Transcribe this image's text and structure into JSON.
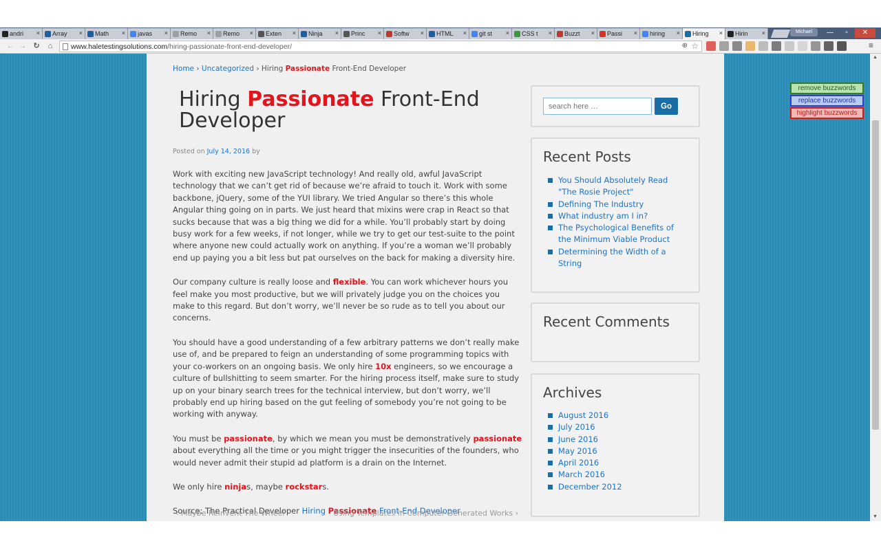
{
  "browser": {
    "tabs": [
      {
        "title": "andri",
        "icon": "github-icon",
        "color": "#222222",
        "active": false
      },
      {
        "title": "Array",
        "icon": "mdn-icon",
        "color": "#1c5fa8",
        "active": false
      },
      {
        "title": "Math",
        "icon": "mdn-icon",
        "color": "#1c5fa8",
        "active": false
      },
      {
        "title": "javas",
        "icon": "google-icon",
        "color": "#4285f4",
        "active": false
      },
      {
        "title": "Remo",
        "icon": "page-icon",
        "color": "#9aa0a6",
        "active": false
      },
      {
        "title": "Remo",
        "icon": "page-icon",
        "color": "#9aa0a6",
        "active": false
      },
      {
        "title": "Exten",
        "icon": "puzzle-icon",
        "color": "#555555",
        "active": false
      },
      {
        "title": "Ninja",
        "icon": "info-icon",
        "color": "#1c5fa8",
        "active": false
      },
      {
        "title": "Princ",
        "icon": "wikipedia-icon",
        "color": "#555555",
        "active": false
      },
      {
        "title": "Softw",
        "icon": "flower-icon",
        "color": "#c0392b",
        "active": false
      },
      {
        "title": "HTML",
        "icon": "mdn-icon",
        "color": "#1c5fa8",
        "active": false
      },
      {
        "title": "git st",
        "icon": "google-icon",
        "color": "#4285f4",
        "active": false
      },
      {
        "title": "CSS t",
        "icon": "css-icon",
        "color": "#3a9a3a",
        "active": false
      },
      {
        "title": "Buzzt",
        "icon": "buzzword-icon",
        "color": "#c0392b",
        "active": false
      },
      {
        "title": "Passi",
        "icon": "gmail-icon",
        "color": "#d93025",
        "active": false
      },
      {
        "title": "hiring",
        "icon": "google-icon",
        "color": "#4285f4",
        "active": false
      },
      {
        "title": "Hiring",
        "icon": "shield-icon",
        "color": "#1a6ea5",
        "active": true
      },
      {
        "title": "Hirin",
        "icon": "dev-icon",
        "color": "#222222",
        "active": false
      }
    ],
    "profile": "Michael",
    "url": {
      "host": "www.haletestingsolutions.com",
      "path": "/hiring-passionate-front-end-developer/"
    },
    "extension_colors": [
      "#d93025",
      "#888888",
      "#666666",
      "#e8a33d",
      "#aaaaaa",
      "#555555",
      "#bbbbbb",
      "#cccccc",
      "#777777",
      "#333333",
      "#222222"
    ]
  },
  "buzz_panel": {
    "remove": "remove buzzwords",
    "replace": "replace buzzwords",
    "highlight": "highlight buzzwords"
  },
  "breadcrumb": {
    "home": "Home",
    "separator": "›",
    "category": "Uncategorized",
    "current_pre": "Hiring ",
    "current_bw": "Passionate",
    "current_post": " Front-End Developer"
  },
  "post": {
    "title_pre": "Hiring ",
    "title_bw": "Passionate",
    "title_post": " Front-End Developer",
    "meta_posted": "Posted on ",
    "meta_date": "July 14, 2016",
    "meta_by": " by",
    "p1": "Work with exciting new JavaScript technology! And really old, awful JavaScript technology that we can’t get rid of because we’re afraid to touch it. Work with some backbone, jQuery, some of the YUI library. We tried Angular so there’s this whole Angular thing going on in parts. We just heard that mixins were crap in React so that sucks because that was a big thing we did for a while. You’ll probably start by doing busy work for a few weeks, if not longer, while we try to get our test-suite to the point where anyone new could actually work on anything. If you’re a woman we’ll probably end up paying you a bit less but pat ourselves on the back for making a diversity hire.",
    "p2_a": "Our company culture is really loose and ",
    "p2_bw": "flexible",
    "p2_b": ". You can work whichever hours you feel make you most productive, but we will privately judge you on the choices you make to this regard. But don’t worry, we’ll never be so rude as to tell you about our concerns.",
    "p3_a": "You should have a good understanding of a few arbitrary patterns we don’t really make use of, and be prepared to feign an understanding of some programming topics with your co-workers on an ongoing basis. We only hire ",
    "p3_bw": "10x",
    "p3_b": " engineers, so we encourage a culture of bullshitting to seem smarter. For the hiring process itself, make sure to study up on your binary search trees for the technical interview, but don’t worry, we’ll probably end up hiring based on the gut feeling of somebody you’re not going to be working with anyway.",
    "p4_a": "You must be ",
    "p4_bw1": "passionate",
    "p4_b": ", by which we mean you must be demonstratively ",
    "p4_bw2": "passionate",
    "p4_c": " about everything all the time or you might trigger the insecurities of the founders, who would never admit their stupid ad platform is a drain on the Internet.",
    "p5_a": "We only hire ",
    "p5_bw1": "ninja",
    "p5_b": "s, maybe ",
    "p5_bw2": "rockstar",
    "p5_c": "s.",
    "source_label": "Source: The Practical Developer ",
    "source_pre": "Hiring ",
    "source_bw": "Passionate",
    "source_post": " Front-End Developer"
  },
  "post_nav": {
    "prev": "‹   Maybe Reinvent The Wheel",
    "next": "Using Templates in Computer-Generated Works   ›"
  },
  "sidebar": {
    "search_placeholder": "search here …",
    "search_button": "Go",
    "recent_posts_title": "Recent Posts",
    "recent_posts": [
      "You Should Absolutely Read \"The Rosie Project\"",
      "Defining The Industry",
      "What industry am I in?",
      "The Psychological Benefits of the Minimum Viable Product",
      "Determining the Width of a String"
    ],
    "recent_comments_title": "Recent Comments",
    "archives_title": "Archives",
    "archives": [
      "August 2016",
      "July 2016",
      "June 2016",
      "May 2016",
      "April 2016",
      "March 2016",
      "December 2012"
    ]
  }
}
